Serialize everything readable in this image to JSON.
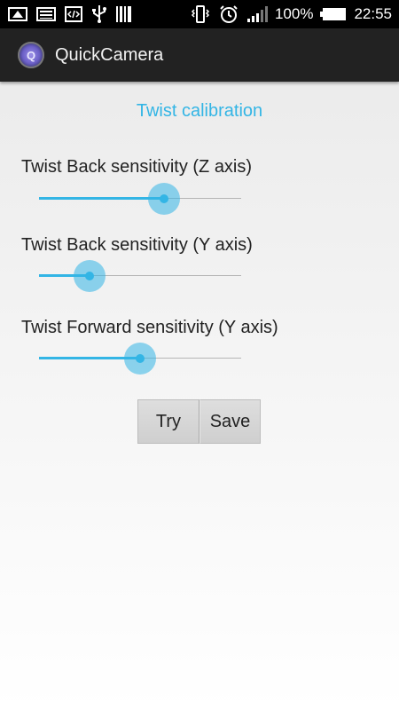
{
  "status_bar": {
    "battery_percent": "100%",
    "time": "22:55",
    "left_icons": [
      "screenshot-notification-icon",
      "gallery-notification-icon",
      "code-notification-icon",
      "usb-icon",
      "barcode-icon"
    ],
    "right_icons": [
      "vibrate-icon",
      "alarm-icon",
      "signal-icon",
      "battery-icon"
    ]
  },
  "action_bar": {
    "app_icon_letter": "Q",
    "title": "QuickCamera"
  },
  "screen": {
    "title": "Twist calibration",
    "accent_color": "#33b5e5"
  },
  "settings": [
    {
      "label": "Twist Back sensitivity (Z axis)",
      "value_fraction": 0.62
    },
    {
      "label": "Twist Back sensitivity (Y axis)",
      "value_fraction": 0.25
    },
    {
      "label": "Twist Forward sensitivity (Y axis)",
      "value_fraction": 0.5
    }
  ],
  "buttons": {
    "try_label": "Try",
    "save_label": "Save"
  }
}
